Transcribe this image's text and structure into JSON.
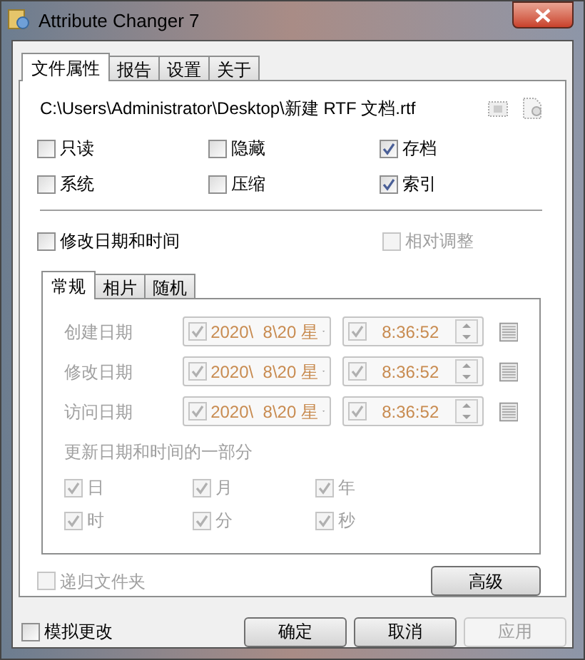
{
  "window": {
    "title": "Attribute Changer 7"
  },
  "tabs": [
    {
      "label": "文件属性",
      "selected": true
    },
    {
      "label": "报告",
      "selected": false
    },
    {
      "label": "设置",
      "selected": false
    },
    {
      "label": "关于",
      "selected": false
    }
  ],
  "file_path": "C:\\Users\\Administrator\\Desktop\\新建 RTF 文档.rtf",
  "attributes": [
    {
      "label": "只读",
      "checked": false
    },
    {
      "label": "隐藏",
      "checked": false
    },
    {
      "label": "存档",
      "checked": true
    },
    {
      "label": "系统",
      "checked": false
    },
    {
      "label": "压缩",
      "checked": false
    },
    {
      "label": "索引",
      "checked": true
    }
  ],
  "modify_datetime": {
    "label": "修改日期和时间",
    "checked": false,
    "disabled": false
  },
  "relative_adjust": {
    "label": "相对调整",
    "checked": false,
    "disabled": true
  },
  "subtabs": [
    {
      "label": "常规",
      "selected": true
    },
    {
      "label": "相片",
      "selected": false
    },
    {
      "label": "随机",
      "selected": false
    }
  ],
  "date_rows": [
    {
      "label": "创建日期",
      "date": "2020\\  8\\20 星",
      "time": "8:36:52",
      "date_checked": true,
      "time_checked": true,
      "disabled": true
    },
    {
      "label": "修改日期",
      "date": "2020\\  8\\20 星",
      "time": "8:36:52",
      "date_checked": true,
      "time_checked": true,
      "disabled": true
    },
    {
      "label": "访问日期",
      "date": "2020\\  8\\20 星",
      "time": "8:36:52",
      "date_checked": true,
      "time_checked": true,
      "disabled": true
    }
  ],
  "update_parts": {
    "label": "更新日期和时间的一部分",
    "items": [
      {
        "label": "日",
        "checked": true,
        "disabled": true
      },
      {
        "label": "月",
        "checked": true,
        "disabled": true
      },
      {
        "label": "年",
        "checked": true,
        "disabled": true
      },
      {
        "label": "时",
        "checked": true,
        "disabled": true
      },
      {
        "label": "分",
        "checked": true,
        "disabled": true
      },
      {
        "label": "秒",
        "checked": true,
        "disabled": true
      }
    ]
  },
  "recursive": {
    "label": "递归文件夹",
    "checked": false,
    "disabled": true
  },
  "advanced_button": {
    "label": "高级",
    "disabled": false
  },
  "simulate": {
    "label": "模拟更改",
    "checked": false
  },
  "buttons": [
    {
      "label": "确定",
      "disabled": false
    },
    {
      "label": "取消",
      "disabled": false
    },
    {
      "label": "应用",
      "disabled": true
    }
  ]
}
